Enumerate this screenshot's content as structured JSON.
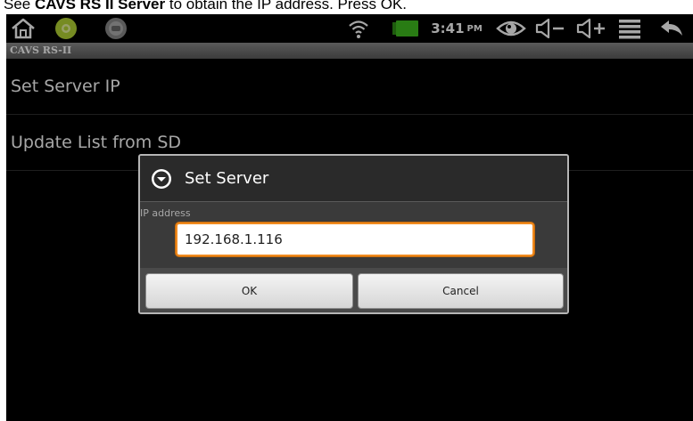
{
  "caption": {
    "prefix": "See ",
    "bold": "CAVS RS II Server",
    "suffix": " to obtain the IP address. Press OK."
  },
  "status_bar": {
    "time": "3:41",
    "ampm": "PM",
    "icons": [
      "home-icon",
      "app-green-icon",
      "app-gray-icon",
      "wifi-icon",
      "battery-icon",
      "eye-icon",
      "volume-down-icon",
      "volume-up-icon",
      "menu-icon",
      "back-icon"
    ]
  },
  "app": {
    "title": "CAVS RS-II"
  },
  "list": {
    "items": [
      {
        "label": "Set Server IP"
      },
      {
        "label": "Update List from SD"
      }
    ]
  },
  "dialog": {
    "title": "Set Server",
    "field_label": "IP address",
    "ip_value": "192.168.1.116",
    "ok_label": "OK",
    "cancel_label": "Cancel"
  },
  "colors": {
    "accent_input_border": "#f08a1e",
    "titlebar": "#707070",
    "battery": "#3fbf1f",
    "app_icon_green": "#b6d635"
  }
}
